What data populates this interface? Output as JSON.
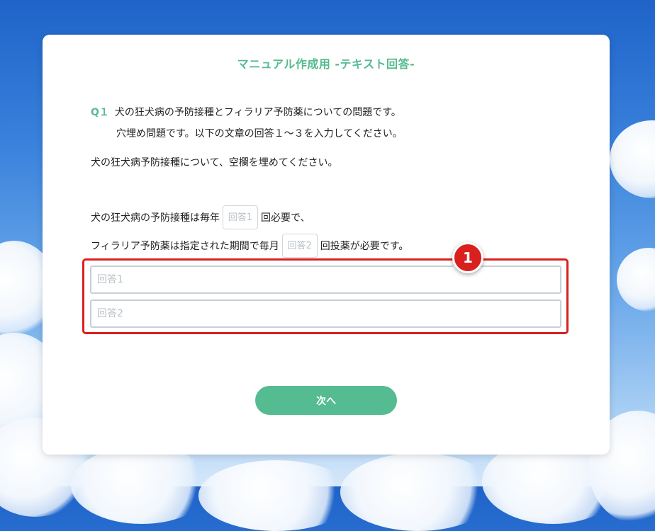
{
  "page": {
    "title": "マニュアル作成用 -テキスト回答-"
  },
  "question": {
    "number": "Q１",
    "line1": "犬の狂犬病の予防接種とフィラリア予防薬についての問題です。",
    "line2": "穴埋め問題です。以下の文章の回答１〜３を入力してください。",
    "intro": "犬の狂犬病予防接種について、空欄を埋めてください。"
  },
  "sentence1": {
    "before": "犬の狂犬病の予防接種は毎年",
    "blank": "回答1",
    "after": "回必要で、"
  },
  "sentence2": {
    "before": "フィラリア予防薬は指定された期間で毎月",
    "blank": "回答2",
    "after": "回投薬が必要です。"
  },
  "answers": [
    {
      "placeholder": "回答1",
      "value": ""
    },
    {
      "placeholder": "回答2",
      "value": ""
    }
  ],
  "annotation": {
    "marker": "1",
    "color": "#d9201f"
  },
  "next_button": {
    "label": "次へ"
  },
  "colors": {
    "accent": "#55bb90",
    "highlight": "#d9201f"
  }
}
